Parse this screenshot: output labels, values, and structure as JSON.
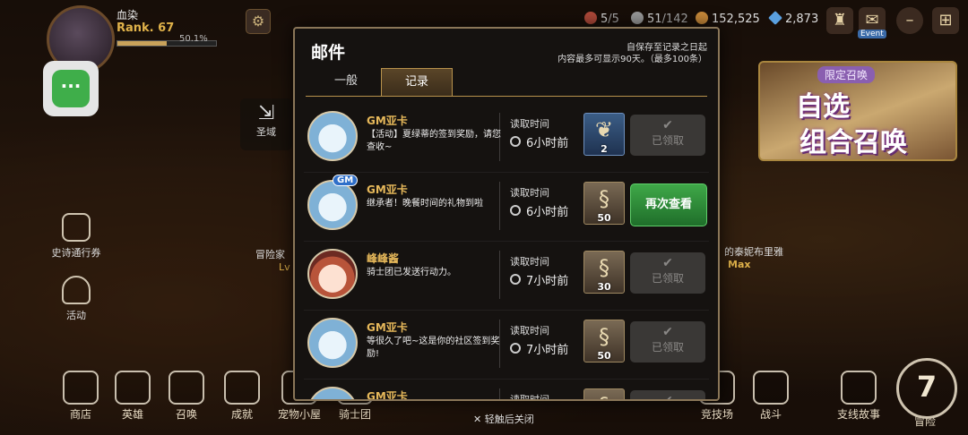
{
  "player": {
    "name": "血染",
    "rank": "Rank. 67",
    "xp": "50.1%",
    "xp_fraction": 0.501
  },
  "resources": [
    {
      "name": "stamina-a",
      "value": "5",
      "sub": "/5",
      "icon": "shield-icon",
      "color": "#b04a3a"
    },
    {
      "name": "stamina-b",
      "value": "51",
      "sub": "/142",
      "icon": "coin-icon",
      "color": "#9a9a9a"
    },
    {
      "name": "gold",
      "value": "152,525",
      "sub": "",
      "icon": "gold-icon",
      "color": "#c98a3a"
    },
    {
      "name": "crystal",
      "value": "2,873",
      "sub": "",
      "icon": "crystal-icon",
      "color": "#5aa0e0"
    }
  ],
  "topbar": {
    "event_label": "Event"
  },
  "side": {
    "epic_pass": "史诗通行券",
    "activity": "活动",
    "holy_land": "圣域"
  },
  "background": {
    "adventure": "冒险家",
    "adventure_lv": "Lv",
    "hero_name": "的泰妮布里雅",
    "hero_max": "Max"
  },
  "banner": {
    "tag": "限定召唤",
    "line1": "自选",
    "line2": "组合召唤"
  },
  "bottom_nav": [
    {
      "label": "商店",
      "icon": "scale-icon"
    },
    {
      "label": "英雄",
      "icon": "hero-icon"
    },
    {
      "label": "召唤",
      "icon": "summon-icon"
    },
    {
      "label": "成就",
      "icon": "scroll-icon"
    },
    {
      "label": "宠物小屋",
      "icon": "pet-icon"
    },
    {
      "label": "骑士团",
      "icon": "knight-icon"
    },
    {
      "label": "竞技场",
      "icon": "arena-icon"
    },
    {
      "label": "战斗",
      "icon": "swords-icon"
    },
    {
      "label": "支线故事",
      "icon": "book-icon"
    },
    {
      "label": "冒险",
      "icon": "seven-icon"
    }
  ],
  "seven_badge": "7",
  "mail": {
    "title": "邮件",
    "note1": "自保存至记录之日起",
    "note2": "内容最多可显示90天。（最多100条）",
    "tabs": [
      {
        "label": "一般",
        "active": false
      },
      {
        "label": "记录",
        "active": true
      }
    ],
    "read_label": "读取时间",
    "close_hint": "轻触后关闭",
    "items": [
      {
        "sender": "GM亚卡",
        "message": "【活动】夏绿蒂的签到奖励，请您查收~",
        "time": "6小时前",
        "reward_qty": "2",
        "reward_icon": "feather-icon",
        "action": "已领取",
        "claimed": true,
        "gm": false,
        "avatar": "slime"
      },
      {
        "sender": "GM亚卡",
        "message": "继承者！晚餐时间的礼物到啦",
        "time": "6小时前",
        "reward_qty": "50",
        "reward_icon": "stamina-icon",
        "action": "再次查看",
        "claimed": false,
        "gm": true,
        "gm_label": "GM",
        "avatar": "slime"
      },
      {
        "sender": "峰峰酱",
        "message": "骑士团已发送行动力。",
        "time": "7小时前",
        "reward_qty": "30",
        "reward_icon": "stamina-icon",
        "action": "已领取",
        "claimed": true,
        "gm": false,
        "avatar": "girl"
      },
      {
        "sender": "GM亚卡",
        "message": "等很久了吧~这是你的社区签到奖励!",
        "time": "7小时前",
        "reward_qty": "50",
        "reward_icon": "stamina-icon",
        "action": "已领取",
        "claimed": true,
        "gm": false,
        "avatar": "slime"
      },
      {
        "sender": "GM亚卡",
        "message": "",
        "time": "",
        "reward_qty": "",
        "reward_icon": "stamina-icon",
        "action": "",
        "claimed": true,
        "gm": false,
        "avatar": "slime"
      }
    ]
  }
}
